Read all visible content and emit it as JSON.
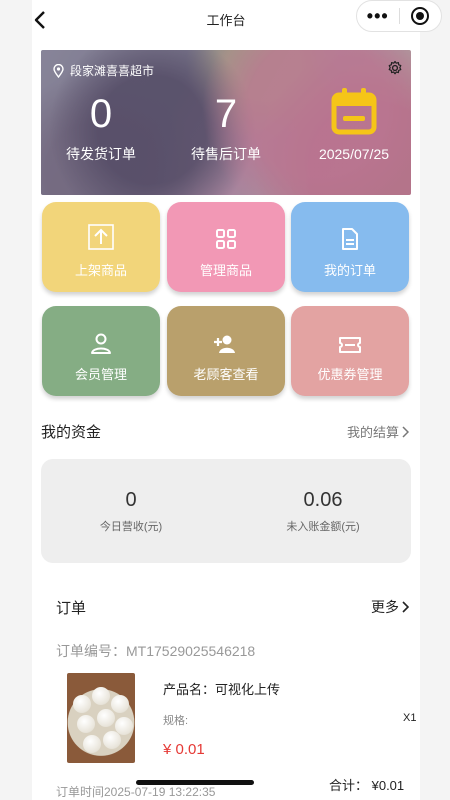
{
  "navbar": {
    "title": "工作台"
  },
  "banner": {
    "store_name": "段家滩喜喜超市",
    "stats": [
      {
        "value": "0",
        "label": "待发货订单"
      },
      {
        "value": "7",
        "label": "待售后订单"
      }
    ],
    "date": "2025/07/25"
  },
  "tiles": [
    {
      "label": "上架商品",
      "icon": "upload-icon",
      "color": "#f2d57a"
    },
    {
      "label": "管理商品",
      "icon": "grid-icon",
      "color": "#f298b5"
    },
    {
      "label": "我的订单",
      "icon": "document-icon",
      "color": "#86bbee"
    },
    {
      "label": "会员管理",
      "icon": "user-icon",
      "color": "#85ad84"
    },
    {
      "label": "老顾客查看",
      "icon": "add-user-icon",
      "color": "#b9a06c"
    },
    {
      "label": "优惠券管理",
      "icon": "ticket-icon",
      "color": "#e3a3a2"
    }
  ],
  "funds": {
    "title": "我的资金",
    "link": "我的结算",
    "items": [
      {
        "value": "0",
        "label": "今日营收(元)"
      },
      {
        "value": "0.06",
        "label": "未入账金额(元)"
      }
    ]
  },
  "orders": {
    "title": "订单",
    "more": "更多",
    "order_no": "订单编号：MT17529025546218",
    "product_name": "产品名：可视化上传",
    "spec": "规格:",
    "qty": "X1",
    "price": "¥ 0.01",
    "time": "订单时间2025-07-19 13:22:35",
    "total": "合计：  ¥0.01"
  }
}
